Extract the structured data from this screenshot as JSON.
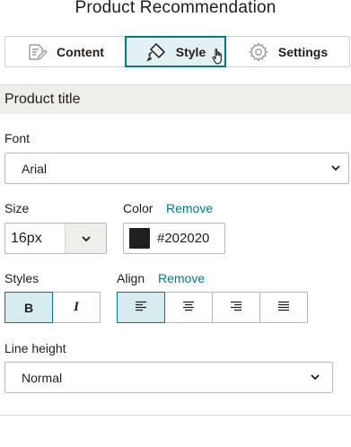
{
  "panel": {
    "title": "Product Recommendation"
  },
  "tabs": [
    {
      "label": "Content",
      "icon": "edit-document-icon"
    },
    {
      "label": "Style",
      "icon": "paint-brush-icon",
      "active": true
    },
    {
      "label": "Settings",
      "icon": "gear-icon"
    }
  ],
  "section": {
    "title": "Product title"
  },
  "font": {
    "label": "Font",
    "value": "Arial"
  },
  "size": {
    "label": "Size",
    "value": "16px"
  },
  "color": {
    "label": "Color",
    "remove_label": "Remove",
    "value": "#202020",
    "swatch": "#202020"
  },
  "styles": {
    "label": "Styles",
    "bold": "B",
    "italic": "I",
    "bold_active": true,
    "italic_active": false
  },
  "align": {
    "label": "Align",
    "remove_label": "Remove",
    "active": "left",
    "options": [
      "left",
      "center",
      "right",
      "justify"
    ]
  },
  "line_height": {
    "label": "Line height",
    "value": "Normal"
  },
  "colors": {
    "accent": "#007c89",
    "active_bg": "#d6ecef",
    "section_bg": "#efeeea",
    "text": "#241c15"
  }
}
